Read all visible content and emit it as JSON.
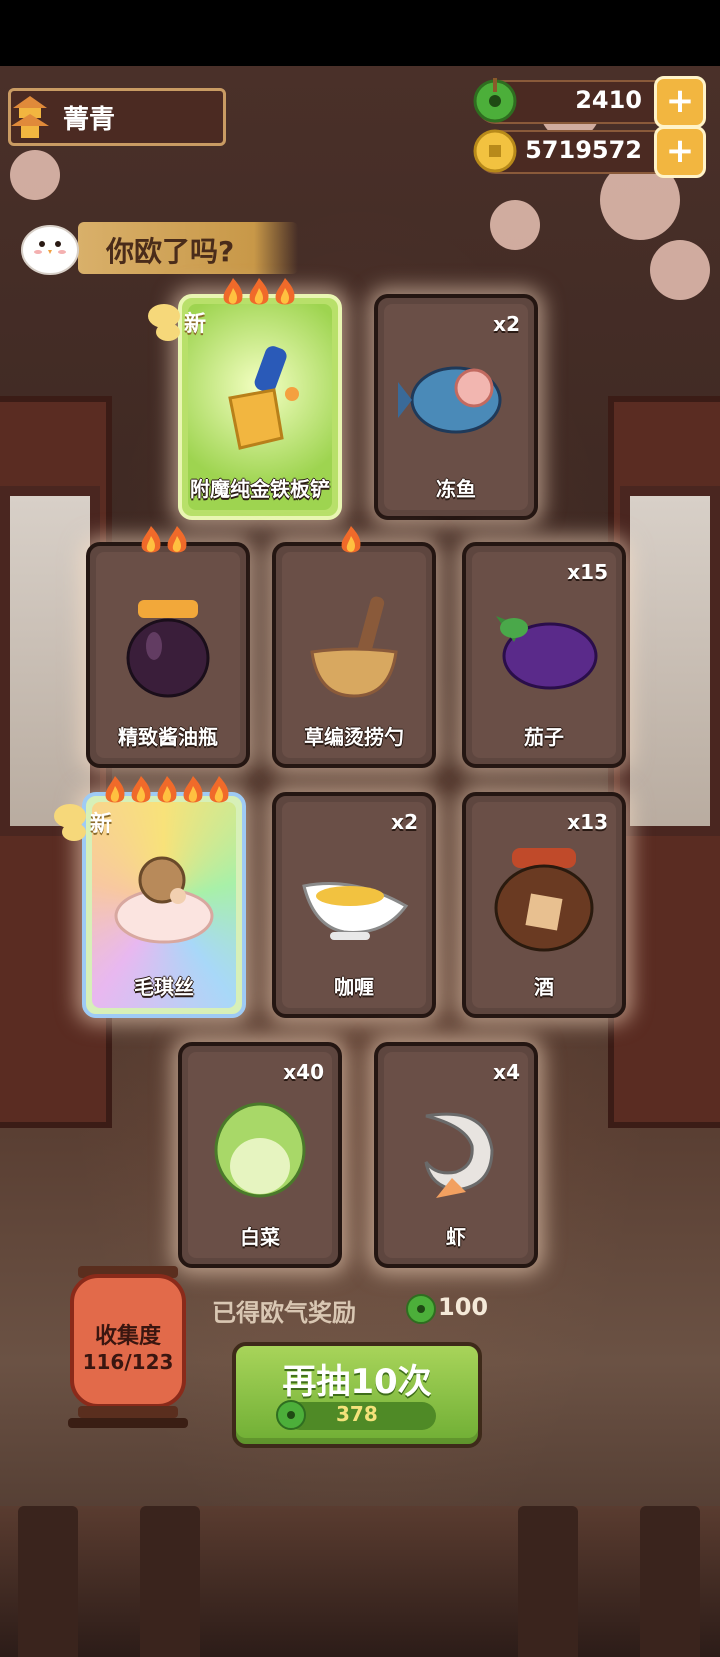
{
  "player": {
    "name": "菁青"
  },
  "currencies": [
    {
      "name": "jade-coin",
      "value": "2410"
    },
    {
      "name": "gold-coin",
      "value": "5719572"
    }
  ],
  "banner": {
    "text": "你欧了吗?"
  },
  "new_label": "新",
  "cards": [
    {
      "name": "附魔纯金铁板铲",
      "count": "",
      "rarity": "gold",
      "flames": 3,
      "is_new": true
    },
    {
      "name": "冻鱼",
      "count": "x2",
      "rarity": "normal",
      "flames": 0,
      "is_new": false
    },
    {
      "name": "精致酱油瓶",
      "count": "",
      "rarity": "normal",
      "flames": 2,
      "is_new": false
    },
    {
      "name": "草编烫捞勺",
      "count": "",
      "rarity": "normal",
      "flames": 1,
      "is_new": false
    },
    {
      "name": "茄子",
      "count": "x15",
      "rarity": "normal",
      "flames": 0,
      "is_new": false
    },
    {
      "name": "毛琪丝",
      "count": "",
      "rarity": "rainbow",
      "flames": 5,
      "is_new": true
    },
    {
      "name": "咖喱",
      "count": "x2",
      "rarity": "normal",
      "flames": 0,
      "is_new": false
    },
    {
      "name": "酒",
      "count": "x13",
      "rarity": "normal",
      "flames": 0,
      "is_new": false
    },
    {
      "name": "白菜",
      "count": "x40",
      "rarity": "normal",
      "flames": 0,
      "is_new": false
    },
    {
      "name": "虾",
      "count": "x4",
      "rarity": "normal",
      "flames": 0,
      "is_new": false
    }
  ],
  "reward": {
    "label": "已得欧气奖励",
    "value": "100"
  },
  "collection": {
    "title": "收集度",
    "progress": "116/123"
  },
  "draw_button": {
    "label": "再抽10次",
    "cost": "378"
  },
  "colors": {
    "jade": "#4caf3a",
    "gold": "#f2b640",
    "button_green": "#8cc447"
  }
}
